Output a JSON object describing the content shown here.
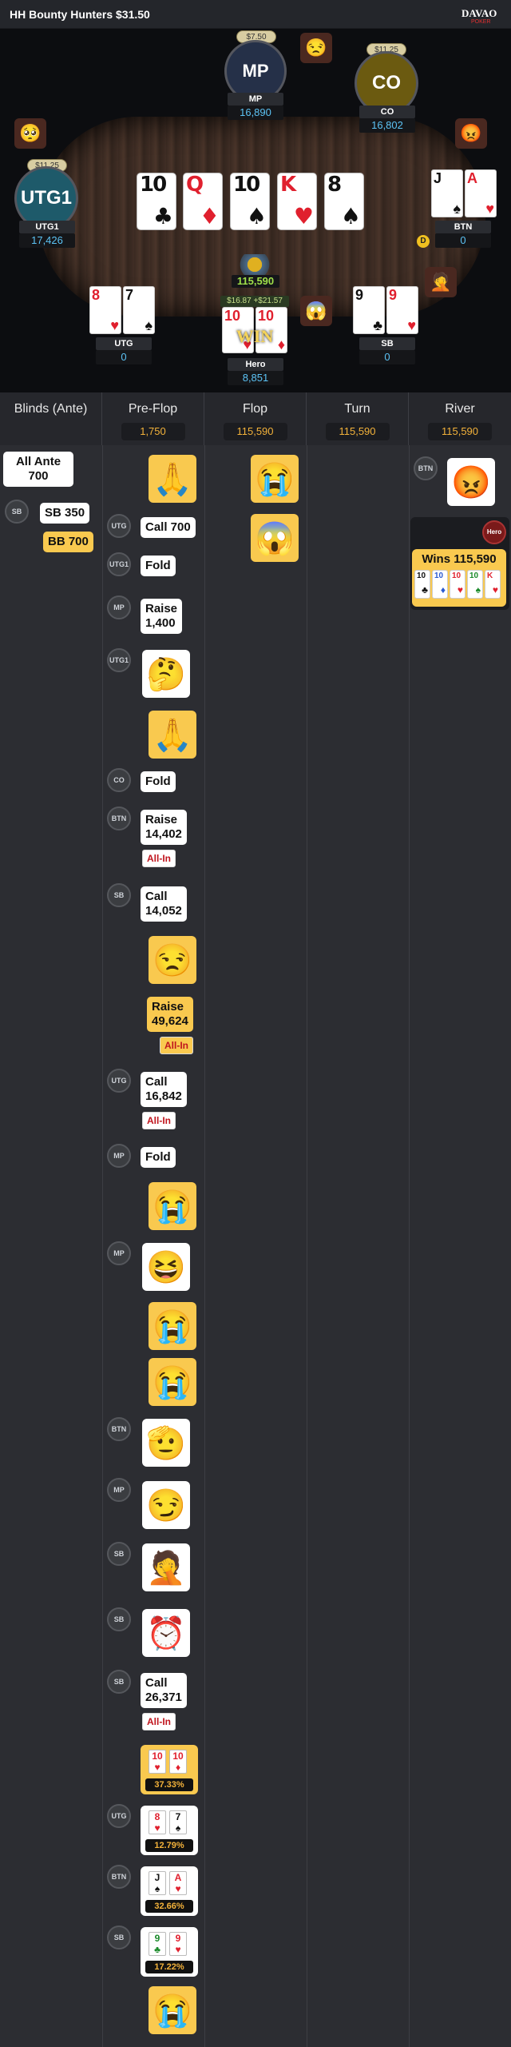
{
  "title": "HH  Bounty Hunters $31.50",
  "logo": "DAVAO POKER",
  "seats": {
    "mp": {
      "name": "MP",
      "avatar": "MP",
      "stack": "16,890",
      "bounty": "$7.50"
    },
    "co": {
      "name": "CO",
      "avatar": "CO",
      "stack": "16,802",
      "bounty": "$11.25"
    },
    "utg1": {
      "name": "UTG1",
      "avatar": "UTG1",
      "stack": "17,426",
      "bounty": "$11.25"
    },
    "btn": {
      "name": "BTN",
      "stack": "0"
    },
    "utg": {
      "name": "UTG",
      "stack": "0"
    },
    "hero": {
      "name": "Hero",
      "stack": "8,851",
      "bounty": "$16.87 +$21.57",
      "win": "WIN"
    },
    "sb": {
      "name": "SB",
      "stack": "0"
    }
  },
  "pot": "115,590",
  "board": [
    {
      "rank": "10",
      "suit": "♣",
      "color": "blk"
    },
    {
      "rank": "Q",
      "suit": "♦",
      "color": "red"
    },
    {
      "rank": "10",
      "suit": "♠",
      "color": "blk"
    },
    {
      "rank": "K",
      "suit": "♥",
      "color": "red"
    },
    {
      "rank": "8",
      "suit": "♠",
      "color": "blk"
    }
  ],
  "hands": {
    "btn": [
      {
        "rank": "J",
        "suit": "♠"
      },
      {
        "rank": "A",
        "suit": "♥"
      }
    ],
    "utg": [
      {
        "rank": "8",
        "suit": "♥"
      },
      {
        "rank": "7",
        "suit": "♠"
      }
    ],
    "hero": [
      {
        "rank": "10",
        "suit": "♥"
      },
      {
        "rank": "10",
        "suit": "♦"
      }
    ],
    "sb": [
      {
        "rank": "9",
        "suit": "♣"
      },
      {
        "rank": "9",
        "suit": "♥"
      }
    ]
  },
  "columns": [
    {
      "name": "Blinds (Ante)",
      "pot": ""
    },
    {
      "name": "Pre-Flop",
      "pot": "1,750"
    },
    {
      "name": "Flop",
      "pot": "115,590"
    },
    {
      "name": "Turn",
      "pot": "115,590"
    },
    {
      "name": "River",
      "pot": "115,590"
    }
  ],
  "blinds": {
    "all_ante": "All Ante\n700",
    "sb_label": "SB",
    "sb": "SB  350",
    "bb": "BB  700"
  },
  "actions": {
    "call700": "Call  700",
    "fold": "Fold",
    "raise1400": "Raise\n1,400",
    "raise14402": "Raise\n14,402",
    "call14052": "Call\n14,052",
    "raise49624": "Raise\n49,624",
    "call16842": "Call\n16,842",
    "call26371": "Call\n26,371",
    "allin": "All-In",
    "wins": "Wins 115,590"
  },
  "positions": {
    "utg": "UTG",
    "utg1": "UTG1",
    "mp": "MP",
    "co": "CO",
    "btn": "BTN",
    "sb": "SB",
    "hero": "Hero"
  },
  "equity": [
    "37.33%",
    "12.79%",
    "32.66%",
    "17.22%"
  ],
  "colors": {
    "accent": "#f9c94f",
    "pot": "#f3b23a",
    "stack": "#5cc3f5",
    "allin": "#c0151d"
  }
}
